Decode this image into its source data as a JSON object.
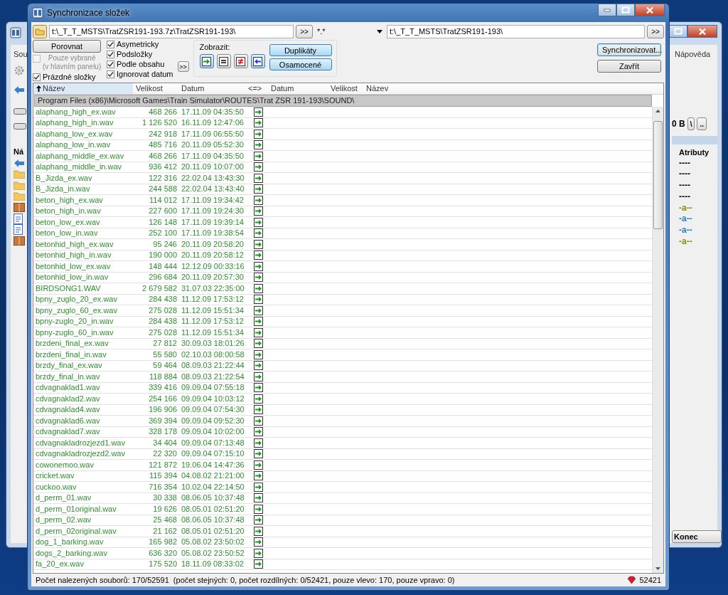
{
  "background_window": {
    "menu": [
      "Sou",
      "Nápověda"
    ],
    "free_space": "0 B",
    "drive_buttons": [
      "\\",
      ".."
    ],
    "columns": [
      "Ná",
      "Atributy"
    ],
    "attributes": [
      {
        "text": "----",
        "color": "#000000"
      },
      {
        "text": "----",
        "color": "#000000"
      },
      {
        "text": "----",
        "color": "#000000"
      },
      {
        "text": "----",
        "color": "#000000"
      },
      {
        "text": "-a--",
        "color": "#8a8a10"
      },
      {
        "text": "-a--",
        "color": "#2a7fd0"
      },
      {
        "text": "-a--",
        "color": "#2a7fd0"
      },
      {
        "text": "-a--",
        "color": "#8a8a10"
      }
    ],
    "left_items": [
      {
        "kind": "up"
      },
      {
        "kind": "folder"
      },
      {
        "kind": "folder"
      },
      {
        "kind": "folder"
      },
      {
        "kind": "archive"
      },
      {
        "kind": "document"
      },
      {
        "kind": "document"
      },
      {
        "kind": "archive"
      }
    ],
    "exit_button": "Konec"
  },
  "window": {
    "title": "Synchronizace složek"
  },
  "paths": {
    "left": "t:\\_T_T_MSTS\\TratZSR191-193.7z\\TratZSR191-193\\",
    "left_browse": ">>",
    "filter": "*.*",
    "right": "t:\\_T_T_MSTS\\TratZSR191-193\\",
    "right_browse": ">>"
  },
  "options": {
    "compare_button": "Porovnat",
    "checkboxes_left": [
      {
        "label": "Pouze vybrané\n(v hlavním panelu)",
        "checked": false,
        "disabled": true
      },
      {
        "label": "Prázdné složky",
        "checked": true,
        "disabled": false
      }
    ],
    "checkboxes_right": [
      {
        "label": "Asymetricky",
        "checked": true,
        "disabled": false
      },
      {
        "label": "Podsložky",
        "checked": true,
        "disabled": false
      },
      {
        "label": "Podle obsahu",
        "checked": true,
        "disabled": false
      },
      {
        "label": "Ignorovat datum",
        "checked": true,
        "disabled": false
      }
    ],
    "more_button": ">>"
  },
  "show": {
    "label": "Zobrazit:",
    "toggles": [
      {
        "kind": "copy_right",
        "selected": true
      },
      {
        "kind": "equal",
        "selected": false
      },
      {
        "kind": "different",
        "selected": false
      },
      {
        "kind": "copy_left",
        "selected": true
      }
    ],
    "buttons": [
      "Duplikáty",
      "Osamocené"
    ]
  },
  "actions": [
    "Synchronizovat...",
    "Zavřít"
  ],
  "table": {
    "columns": [
      {
        "label": "Název",
        "sorted": true
      },
      {
        "label": "Velikost",
        "sorted": false
      },
      {
        "label": "Datum",
        "sorted": false
      },
      {
        "label": "<=>",
        "sorted": false
      },
      {
        "label": "Datum",
        "sorted": false
      },
      {
        "label": "Velikost",
        "sorted": false
      },
      {
        "label": "Název",
        "sorted": false
      }
    ],
    "folder": "Program Files (x86)\\Microsoft Games\\Train Simulator\\ROUTES\\Trat ZSR 191-193\\SOUND\\",
    "rows": [
      {
        "name": "alaphang_high_ex.wav",
        "size": "468 266",
        "date": "17.11.09 04:35:50",
        "kind": "copy_right"
      },
      {
        "name": "alaphang_high_in.wav",
        "size": "1 126 520",
        "date": "16.11.09 12:47:06",
        "kind": "copy_right"
      },
      {
        "name": "alaphang_low_ex.wav",
        "size": "242 918",
        "date": "17.11.09 06:55:50",
        "kind": "copy_right"
      },
      {
        "name": "alaphang_low_in.wav",
        "size": "485 716",
        "date": "20.11.09 05:52:30",
        "kind": "copy_right"
      },
      {
        "name": "alaphang_middle_ex.wav",
        "size": "468 266",
        "date": "17.11.09 04:35:50",
        "kind": "copy_right"
      },
      {
        "name": "alaphang_middle_in.wav",
        "size": "936 412",
        "date": "20.11.09 10:07:00",
        "kind": "copy_right"
      },
      {
        "name": "B_Jizda_ex.wav",
        "size": "122 316",
        "date": "22.02.04 13:43:30",
        "kind": "copy_right"
      },
      {
        "name": "B_Jizda_in.wav",
        "size": "244 588",
        "date": "22.02.04 13:43:40",
        "kind": "copy_right"
      },
      {
        "name": "beton_high_ex.wav",
        "size": "114 012",
        "date": "17.11.09 19:34:42",
        "kind": "copy_right"
      },
      {
        "name": "beton_high_in.wav",
        "size": "227 600",
        "date": "17.11.09 19:24:30",
        "kind": "copy_right"
      },
      {
        "name": "beton_low_ex.wav",
        "size": "126 148",
        "date": "17.11.09 19:39:14",
        "kind": "copy_right"
      },
      {
        "name": "beton_low_in.wav",
        "size": "252 100",
        "date": "17.11.09 19:38:54",
        "kind": "copy_right"
      },
      {
        "name": "betonhid_high_ex.wav",
        "size": "95 246",
        "date": "20.11.09 20:58:20",
        "kind": "copy_right"
      },
      {
        "name": "betonhid_high_in.wav",
        "size": "190 000",
        "date": "20.11.09 20:58:12",
        "kind": "copy_right"
      },
      {
        "name": "betonhid_low_ex.wav",
        "size": "148 444",
        "date": "12.12.09 00:33:16",
        "kind": "copy_right"
      },
      {
        "name": "betonhid_low_in.wav",
        "size": "296 684",
        "date": "20.11.09 20:57:30",
        "kind": "copy_right"
      },
      {
        "name": "BIRDSONG1.WAV",
        "size": "2 679 582",
        "date": "31.07.03 22:35:00",
        "kind": "copy_right"
      },
      {
        "name": "bpny_zuglo_20_ex.wav",
        "size": "284 438",
        "date": "11.12.09 17:53:12",
        "kind": "copy_right"
      },
      {
        "name": "bpny_zuglo_60_ex.wav",
        "size": "275 028",
        "date": "11.12.09 15:51:34",
        "kind": "copy_right"
      },
      {
        "name": "bpny-zuglo_20_in.wav",
        "size": "284 438",
        "date": "11.12.09 17:53:12",
        "kind": "copy_right"
      },
      {
        "name": "bpny-zuglo_60_in.wav",
        "size": "275 028",
        "date": "11.12.09 15:51:34",
        "kind": "copy_right"
      },
      {
        "name": "brzdeni_final_ex.wav",
        "size": "27 812",
        "date": "30.09.03 18:01:26",
        "kind": "copy_right"
      },
      {
        "name": "brzdeni_final_in.wav",
        "size": "55 580",
        "date": "02.10.03 08:00:58",
        "kind": "copy_right"
      },
      {
        "name": "brzdy_final_ex.wav",
        "size": "59 464",
        "date": "08.09.03 21:22:44",
        "kind": "copy_right"
      },
      {
        "name": "brzdy_final_in.wav",
        "size": "118 884",
        "date": "08.09.03 21:22:54",
        "kind": "copy_right"
      },
      {
        "name": "cdvagnaklad1.wav",
        "size": "339 416",
        "date": "09.09.04 07:55:18",
        "kind": "copy_right"
      },
      {
        "name": "cdvagnaklad2.wav",
        "size": "254 166",
        "date": "09.09.04 10:03:12",
        "kind": "copy_right"
      },
      {
        "name": "cdvagnaklad4.wav",
        "size": "196 906",
        "date": "09.09.04 07:54:30",
        "kind": "copy_right"
      },
      {
        "name": "cdvagnaklad6.wav",
        "size": "369 394",
        "date": "09.09.04 09:52:30",
        "kind": "copy_right"
      },
      {
        "name": "cdvagnaklad7.wav",
        "size": "328 178",
        "date": "09.09.04 10:02:00",
        "kind": "copy_right"
      },
      {
        "name": "cdvagnakladrozjezd1.wav",
        "size": "34 404",
        "date": "09.09.04 07:13:48",
        "kind": "copy_right"
      },
      {
        "name": "cdvagnakladrozjezd2.wav",
        "size": "22 320",
        "date": "09.09.04 07:15:10",
        "kind": "copy_right"
      },
      {
        "name": "cowonemoo.wav",
        "size": "121 872",
        "date": "19.06.04 14:47:36",
        "kind": "copy_right"
      },
      {
        "name": "cricket.wav",
        "size": "115 394",
        "date": "04.08.02 21:21:00",
        "kind": "copy_right"
      },
      {
        "name": "cuckoo.wav",
        "size": "716 354",
        "date": "10.02.04 22:14:50",
        "kind": "copy_right"
      },
      {
        "name": "d_perm_01.wav",
        "size": "30 338",
        "date": "08.06.05 10:37:48",
        "kind": "copy_right"
      },
      {
        "name": "d_perm_01original.wav",
        "size": "19 626",
        "date": "08.05.01 02:51:20",
        "kind": "copy_right"
      },
      {
        "name": "d_perm_02.wav",
        "size": "25 468",
        "date": "08.06.05 10:37:48",
        "kind": "copy_right"
      },
      {
        "name": "d_perm_02original.wav",
        "size": "21 162",
        "date": "08.05.01 02:51:20",
        "kind": "copy_right"
      },
      {
        "name": "dog_1_barking.wav",
        "size": "165 982",
        "date": "05.08.02 23:50:02",
        "kind": "copy_right"
      },
      {
        "name": "dogs_2_barking.wav",
        "size": "636 320",
        "date": "05.08.02 23:50:52",
        "kind": "copy_right"
      },
      {
        "name": "fa_20_ex.wav",
        "size": "175 520",
        "date": "18.11.09 08:33:02",
        "kind": "copy_right"
      }
    ]
  },
  "status_bar": {
    "text": "Počet nalezených souborů: 170/52591  (počet stejných: 0, počet rozdílných: 0/52421, pouze vlevo: 170, pouze vpravo: 0)",
    "count": "52421"
  }
}
